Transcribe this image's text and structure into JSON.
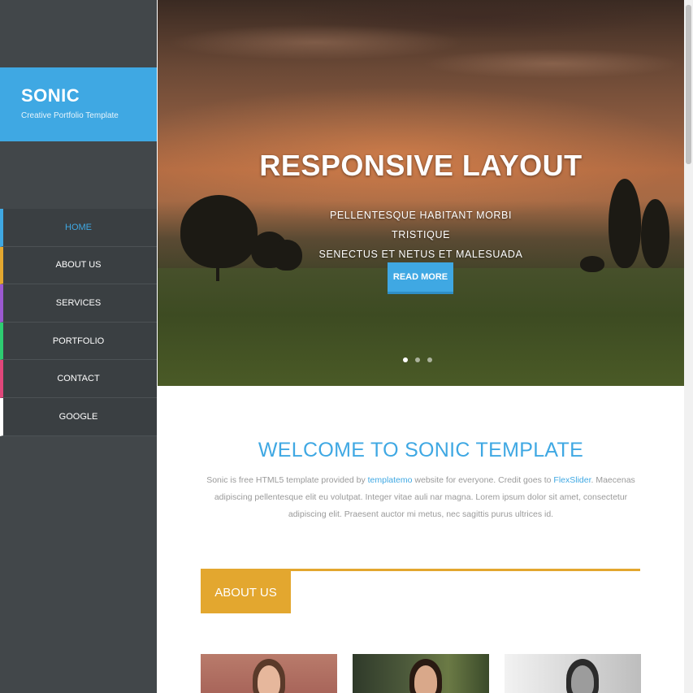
{
  "brand": {
    "title": "SONIC",
    "subtitle": "Creative Portfolio Template"
  },
  "nav": {
    "items": [
      {
        "label": "HOME",
        "color": "#3fa8e3"
      },
      {
        "label": "ABOUT US",
        "color": "#e3a72f"
      },
      {
        "label": "SERVICES",
        "color": "#9b59d0"
      },
      {
        "label": "PORTFOLIO",
        "color": "#2ecc71"
      },
      {
        "label": "CONTACT",
        "color": "#e0477a"
      },
      {
        "label": "GOOGLE",
        "color": "#ffffff"
      }
    ]
  },
  "hero": {
    "title": "RESPONSIVE LAYOUT",
    "text_line1": "PELLENTESQUE HABITANT MORBI TRISTIQUE",
    "text_line2": "SENECTUS ET NETUS ET MALESUADA FAMES.",
    "button_label": "READ MORE"
  },
  "welcome": {
    "heading": "WELCOME TO SONIC TEMPLATE",
    "intro_part1": "Sonic is free HTML5 template provided by ",
    "intro_link1": "templatemo",
    "intro_part2": " website for everyone. Credit goes to ",
    "intro_link2": "FlexSlider",
    "intro_part3": ". Maecenas adipiscing pellentesque elit eu volutpat. Integer vitae auli nar magna. Lorem ipsum dolor sit amet, consectetur adipiscing elit. Praesent auctor mi metus, nec sagittis purus ultrices id."
  },
  "about": {
    "tab_label": "ABOUT US"
  },
  "colors": {
    "accent_blue": "#3fa8e3",
    "accent_gold": "#e3a72f",
    "sidebar_bg": "#42474a"
  }
}
